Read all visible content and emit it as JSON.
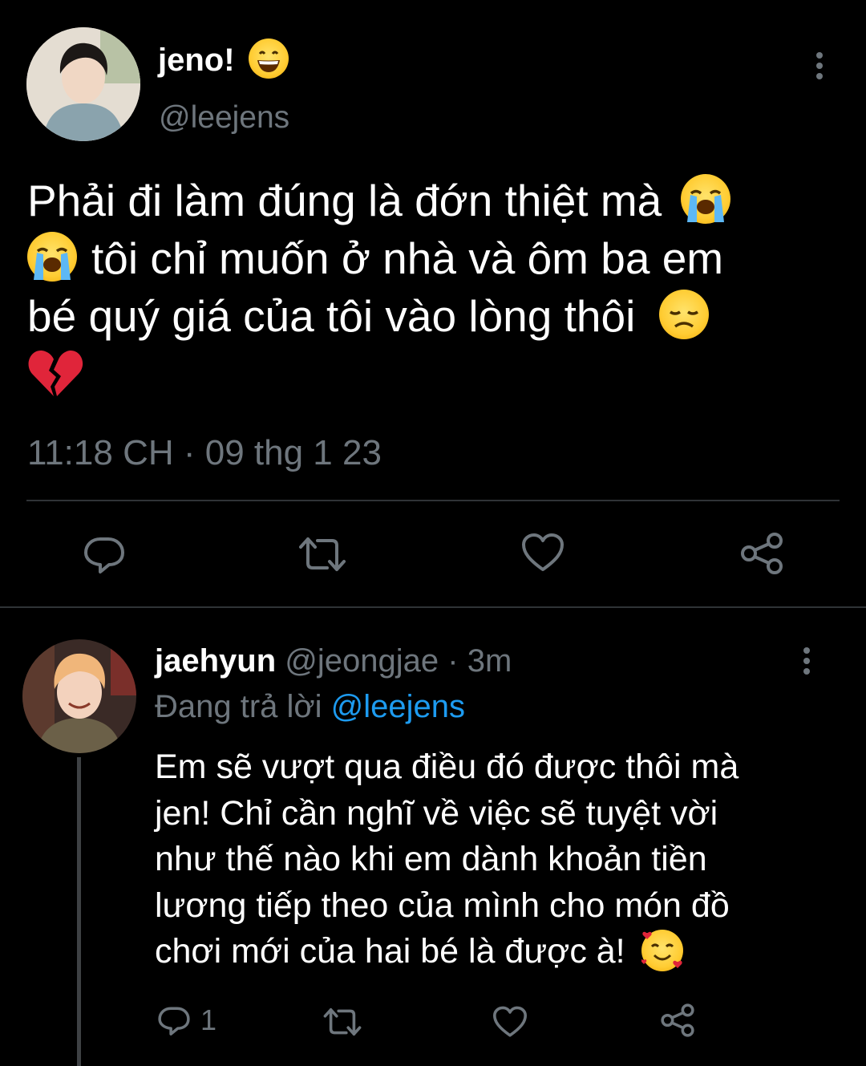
{
  "main_tweet": {
    "display_name": "jeno!",
    "name_emoji": "grinning-face-emoji",
    "handle": "@leejens",
    "text_lines": [
      "Phải đi làm đúng là đớn thiệt mà",
      "tôi chỉ muốn ở nhà và ôm ba em",
      "bé quý giá của tôi vào lòng thôi"
    ],
    "emojis": [
      "loudly-crying-emoji",
      "loudly-crying-emoji",
      "disappointed-emoji",
      "broken-heart-emoji"
    ],
    "timestamp": "11:18 CH · 09 thg 1 23",
    "actions": [
      "reply-icon",
      "retweet-icon",
      "like-icon",
      "share-icon"
    ]
  },
  "reply_tweet": {
    "display_name": "jaehyun",
    "handle": "@jeongjae",
    "age": "· 3m",
    "replying_prefix": "Đang trả lời",
    "replying_handle": "@leejens",
    "text_lines": [
      "Em sẽ vượt qua điều đó được thôi mà",
      "jen! Chỉ cần nghĩ về việc sẽ tuyệt vời",
      "như thế nào khi em dành khoản tiền",
      "lương tiếp theo của mình cho món đồ",
      "chơi mới của hai bé là được à!"
    ],
    "end_emoji": "smiling-face-with-hearts-emoji",
    "reply_count": "1",
    "actions": [
      "reply-icon",
      "retweet-icon",
      "like-icon",
      "share-icon"
    ]
  },
  "colors": {
    "background": "#000000",
    "muted": "#6e767d",
    "link": "#1d9bf0",
    "divider": "#2f3336"
  }
}
